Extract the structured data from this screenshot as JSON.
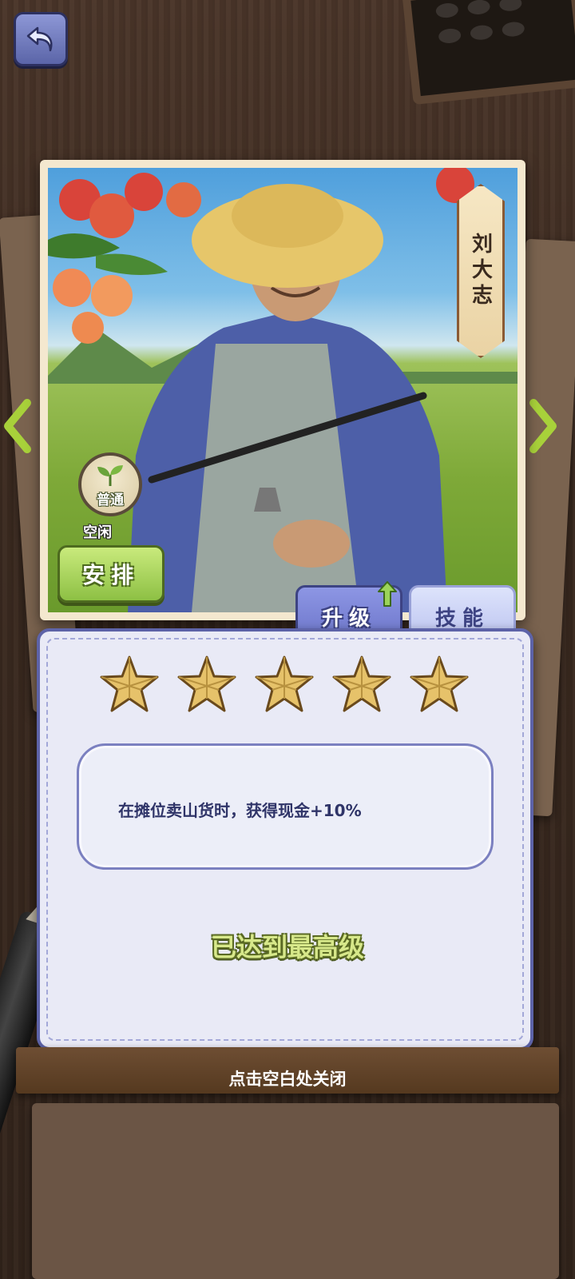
{
  "character": {
    "name": "刘大志",
    "rank": "普通",
    "status": "空闲"
  },
  "buttons": {
    "arrange": "安排",
    "back_icon": "back-arrow-icon"
  },
  "tabs": [
    {
      "label": "升级",
      "active": true
    },
    {
      "label": "技能",
      "active": false
    }
  ],
  "stars": {
    "filled": 5,
    "total": 5
  },
  "skill": {
    "description": "在摊位卖山货时，获得现金+10%"
  },
  "level_status": "已达到最高级",
  "footer": {
    "close_hint": "点击空白处关闭"
  },
  "colors": {
    "tab_active": "#6a73c8",
    "arrange_button": "#8dc044",
    "max_text": "#d7e88a",
    "star": "#e6c26a"
  }
}
